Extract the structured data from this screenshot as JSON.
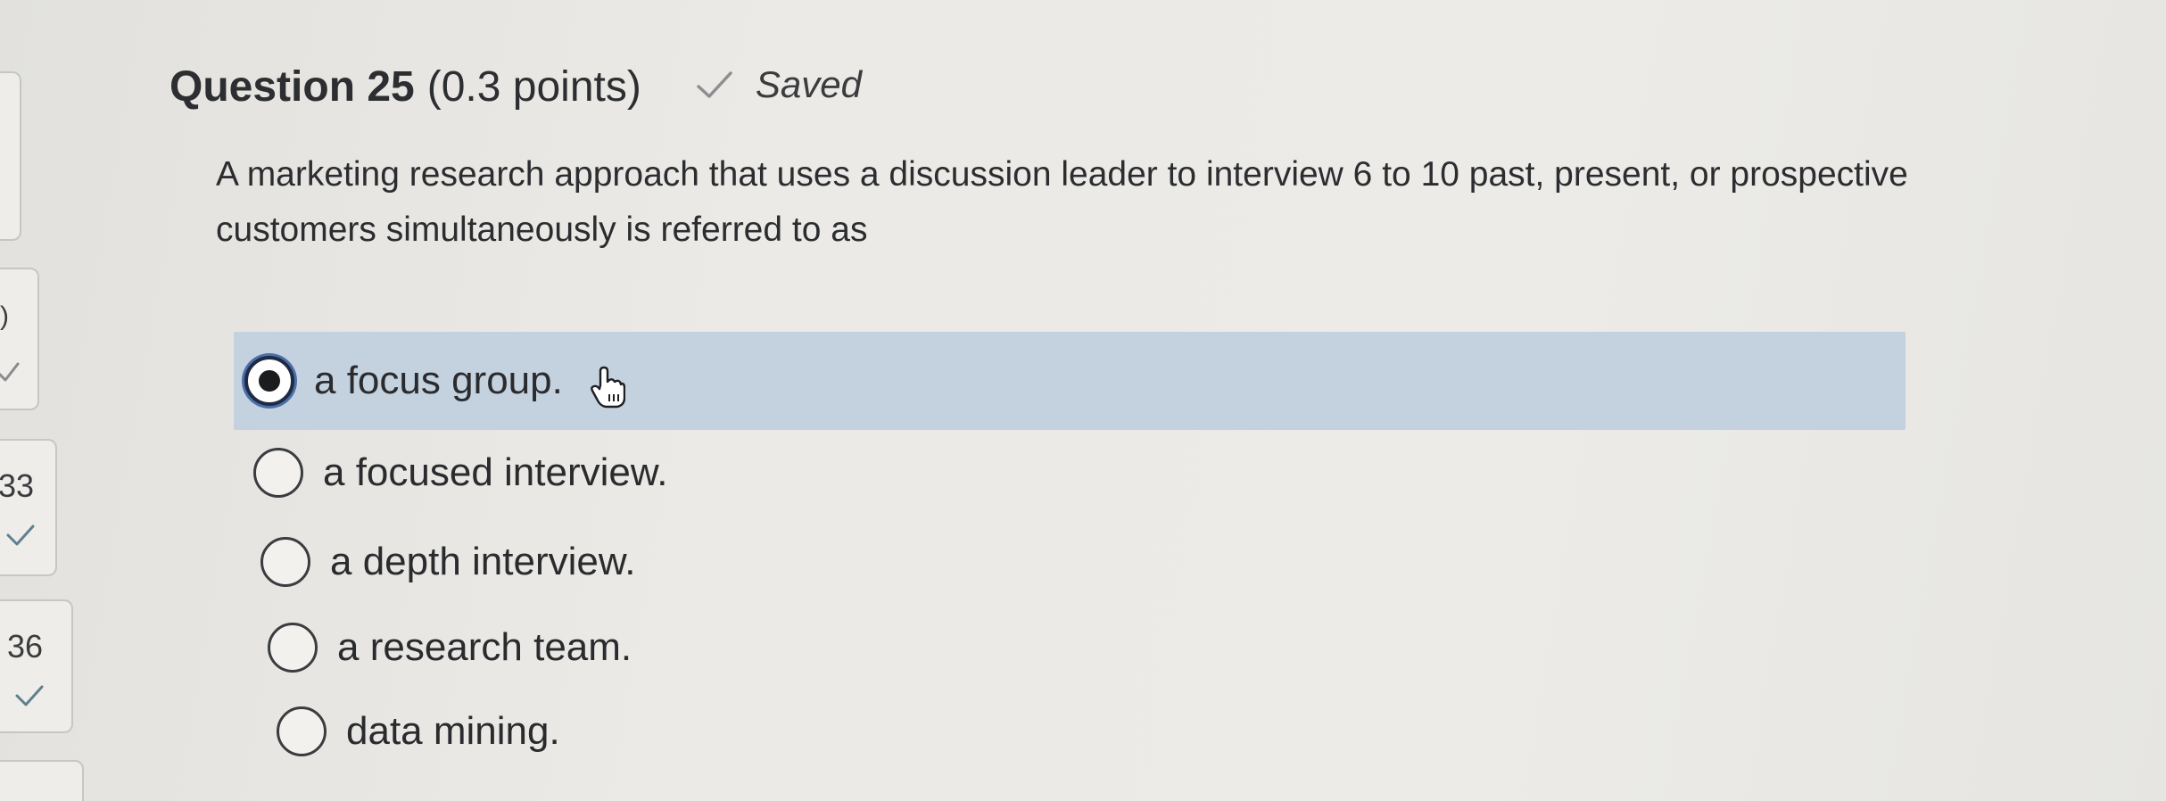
{
  "nav": {
    "items": [
      {
        "number": "",
        "status": ""
      },
      {
        "number": "",
        "status": "answered"
      },
      {
        "number": "33",
        "status": "answered"
      },
      {
        "number": "36",
        "status": "answered"
      }
    ]
  },
  "question": {
    "title": "Question 25",
    "points": "(0.3 points)",
    "saved_label": "Saved",
    "text": "A marketing research approach that uses a discussion leader to interview 6 to 10 past, present, or prospective customers simultaneously is referred to as"
  },
  "options": [
    {
      "label": "a focus group.",
      "selected": true
    },
    {
      "label": "a focused interview.",
      "selected": false
    },
    {
      "label": "a depth interview.",
      "selected": false
    },
    {
      "label": "a research team.",
      "selected": false
    },
    {
      "label": "data mining.",
      "selected": false
    }
  ],
  "colors": {
    "selected_row": "#c4d1de",
    "radio_focus": "#4a6fa8"
  }
}
